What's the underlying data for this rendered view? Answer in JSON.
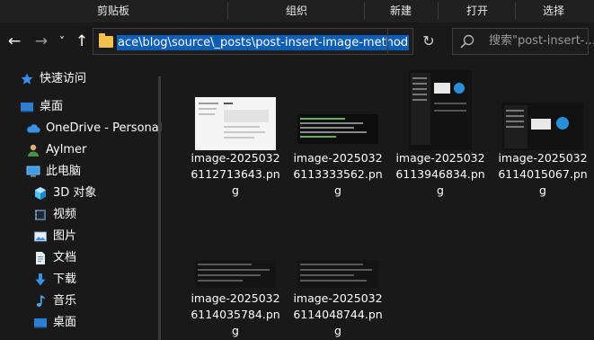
{
  "ribbon": {
    "groups": [
      "剪贴板",
      "组织",
      "新建",
      "打开",
      "选择"
    ]
  },
  "toolbar": {
    "back_icon": "←",
    "forward_icon": "→",
    "recent_icon": "˅",
    "up_icon": "↑",
    "refresh_icon": "↻",
    "dropdown_icon": "⌄"
  },
  "address": {
    "path": "ace\\blog\\source\\_posts\\post-insert-image-method"
  },
  "search": {
    "placeholder": "搜索\"post-insert-..."
  },
  "nav": {
    "items": [
      {
        "label": "快速访问",
        "icon": "star-icon"
      },
      {
        "label": "桌面",
        "icon": "desktop-icon"
      },
      {
        "label": "OneDrive - Personal",
        "icon": "cloud-icon"
      },
      {
        "label": "Aylmer",
        "icon": "user-icon"
      },
      {
        "label": "此电脑",
        "icon": "computer-icon"
      },
      {
        "label": "3D 对象",
        "icon": "cube-icon"
      },
      {
        "label": "视频",
        "icon": "video-icon"
      },
      {
        "label": "图片",
        "icon": "picture-icon"
      },
      {
        "label": "文档",
        "icon": "document-icon"
      },
      {
        "label": "下载",
        "icon": "download-icon"
      },
      {
        "label": "音乐",
        "icon": "music-icon"
      },
      {
        "label": "桌面",
        "icon": "desktop-icon"
      }
    ]
  },
  "files": [
    {
      "name": "image-20250326112713643.png"
    },
    {
      "name": "image-20250326113333562.png"
    },
    {
      "name": "image-20250326113946834.png"
    },
    {
      "name": "image-20250326114015067.png"
    },
    {
      "name": "image-20250326114035784.png"
    },
    {
      "name": "image-20250326114048744.png"
    }
  ],
  "colors": {
    "background": "#191919",
    "selection": "#0a5fb4",
    "folder": "#f2c14e"
  }
}
